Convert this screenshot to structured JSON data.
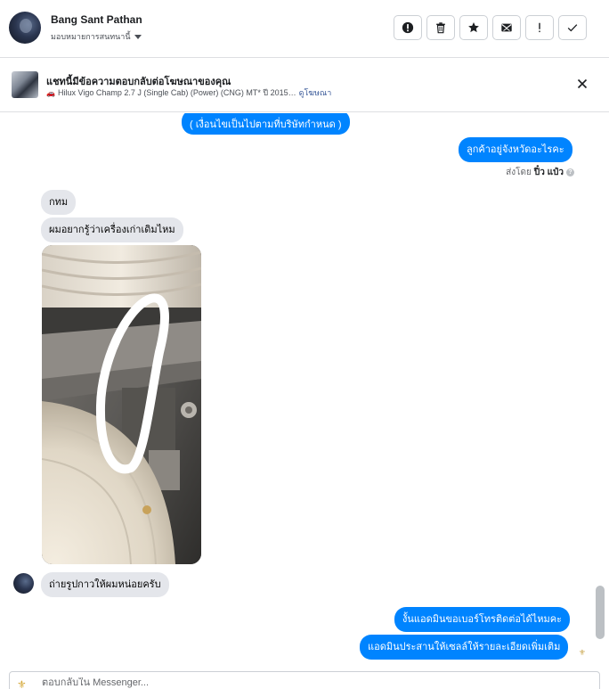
{
  "header": {
    "name": "Bang Sant Pathan",
    "assign_label": "มอบหมายการสนทนานี้",
    "actions": [
      {
        "icon": "alert-circle-icon"
      },
      {
        "icon": "trash-icon"
      },
      {
        "icon": "star-icon"
      },
      {
        "icon": "mark-unread-icon"
      },
      {
        "icon": "exclamation-icon"
      },
      {
        "icon": "check-icon"
      }
    ]
  },
  "ad": {
    "title": "แชทนี้มีข้อความตอบกลับต่อโฆษณาของคุณ",
    "car": "Hilux Vigo Champ 2.7 J (Single Cab) (Power) (CNG) MT* ปี 2015…",
    "link": "ดูโฆษณา"
  },
  "messages": [
    {
      "dir": "out",
      "text": "( เงื่อนไขเป็นไปตามที่บริษัทกำหนด )"
    },
    {
      "dir": "out",
      "text": "ลูกค้าอยู่จังหวัดอะไรคะ"
    },
    {
      "dir": "in",
      "text": "กทม"
    },
    {
      "dir": "in",
      "text": "ผมอยากรู้ว่าเครื่องเก่าเดิมไหม"
    },
    {
      "dir": "in",
      "text": "ถ่ายรูปกาวให้ผมหน่อยครับ"
    },
    {
      "dir": "out",
      "text": "งั้นแอดมินขอเบอร์โทรติดต่อได้ไหมคะ"
    },
    {
      "dir": "out",
      "text": "แอดมินประสานให้เซลล์ให้รายละเอียดเพิ่มเติม"
    }
  ],
  "sent_by": {
    "prefix": "ส่งโดย",
    "name": "ปิ๋ว แป๋ว"
  },
  "reply": {
    "placeholder": "ตอบกลับใน Messenger..."
  },
  "colors": {
    "outgoing": "#0084ff",
    "incoming": "#e4e6eb"
  }
}
